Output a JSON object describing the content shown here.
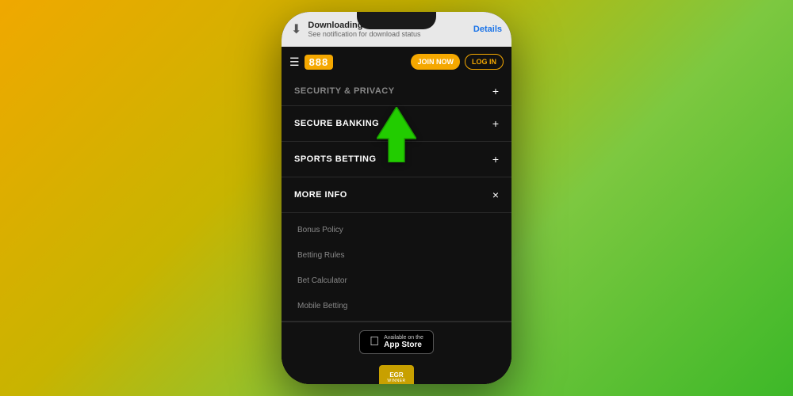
{
  "background": {
    "gradient": "yellow-green"
  },
  "phone": {
    "download_bar": {
      "title": "Downloading file...",
      "subtitle": "See notification for download status",
      "details_label": "Details"
    },
    "top_nav": {
      "brand": "888",
      "join_label": "JOIN NOW",
      "login_label": "LOG IN"
    },
    "menu": {
      "partial_item": "SECURITY & PRIVACY",
      "items": [
        {
          "label": "SECURE BANKING",
          "icon": "+"
        },
        {
          "label": "SPORTS BETTING",
          "icon": "+"
        },
        {
          "label": "MORE INFO",
          "icon": "×"
        }
      ],
      "sub_items": [
        "Bonus Policy",
        "Betting Rules",
        "Bet Calculator",
        "Mobile Betting"
      ]
    },
    "app_store": {
      "available_on": "Available on the",
      "name": "App Store"
    },
    "egr": {
      "label": "EGR",
      "sub_label": "WINNER"
    }
  }
}
